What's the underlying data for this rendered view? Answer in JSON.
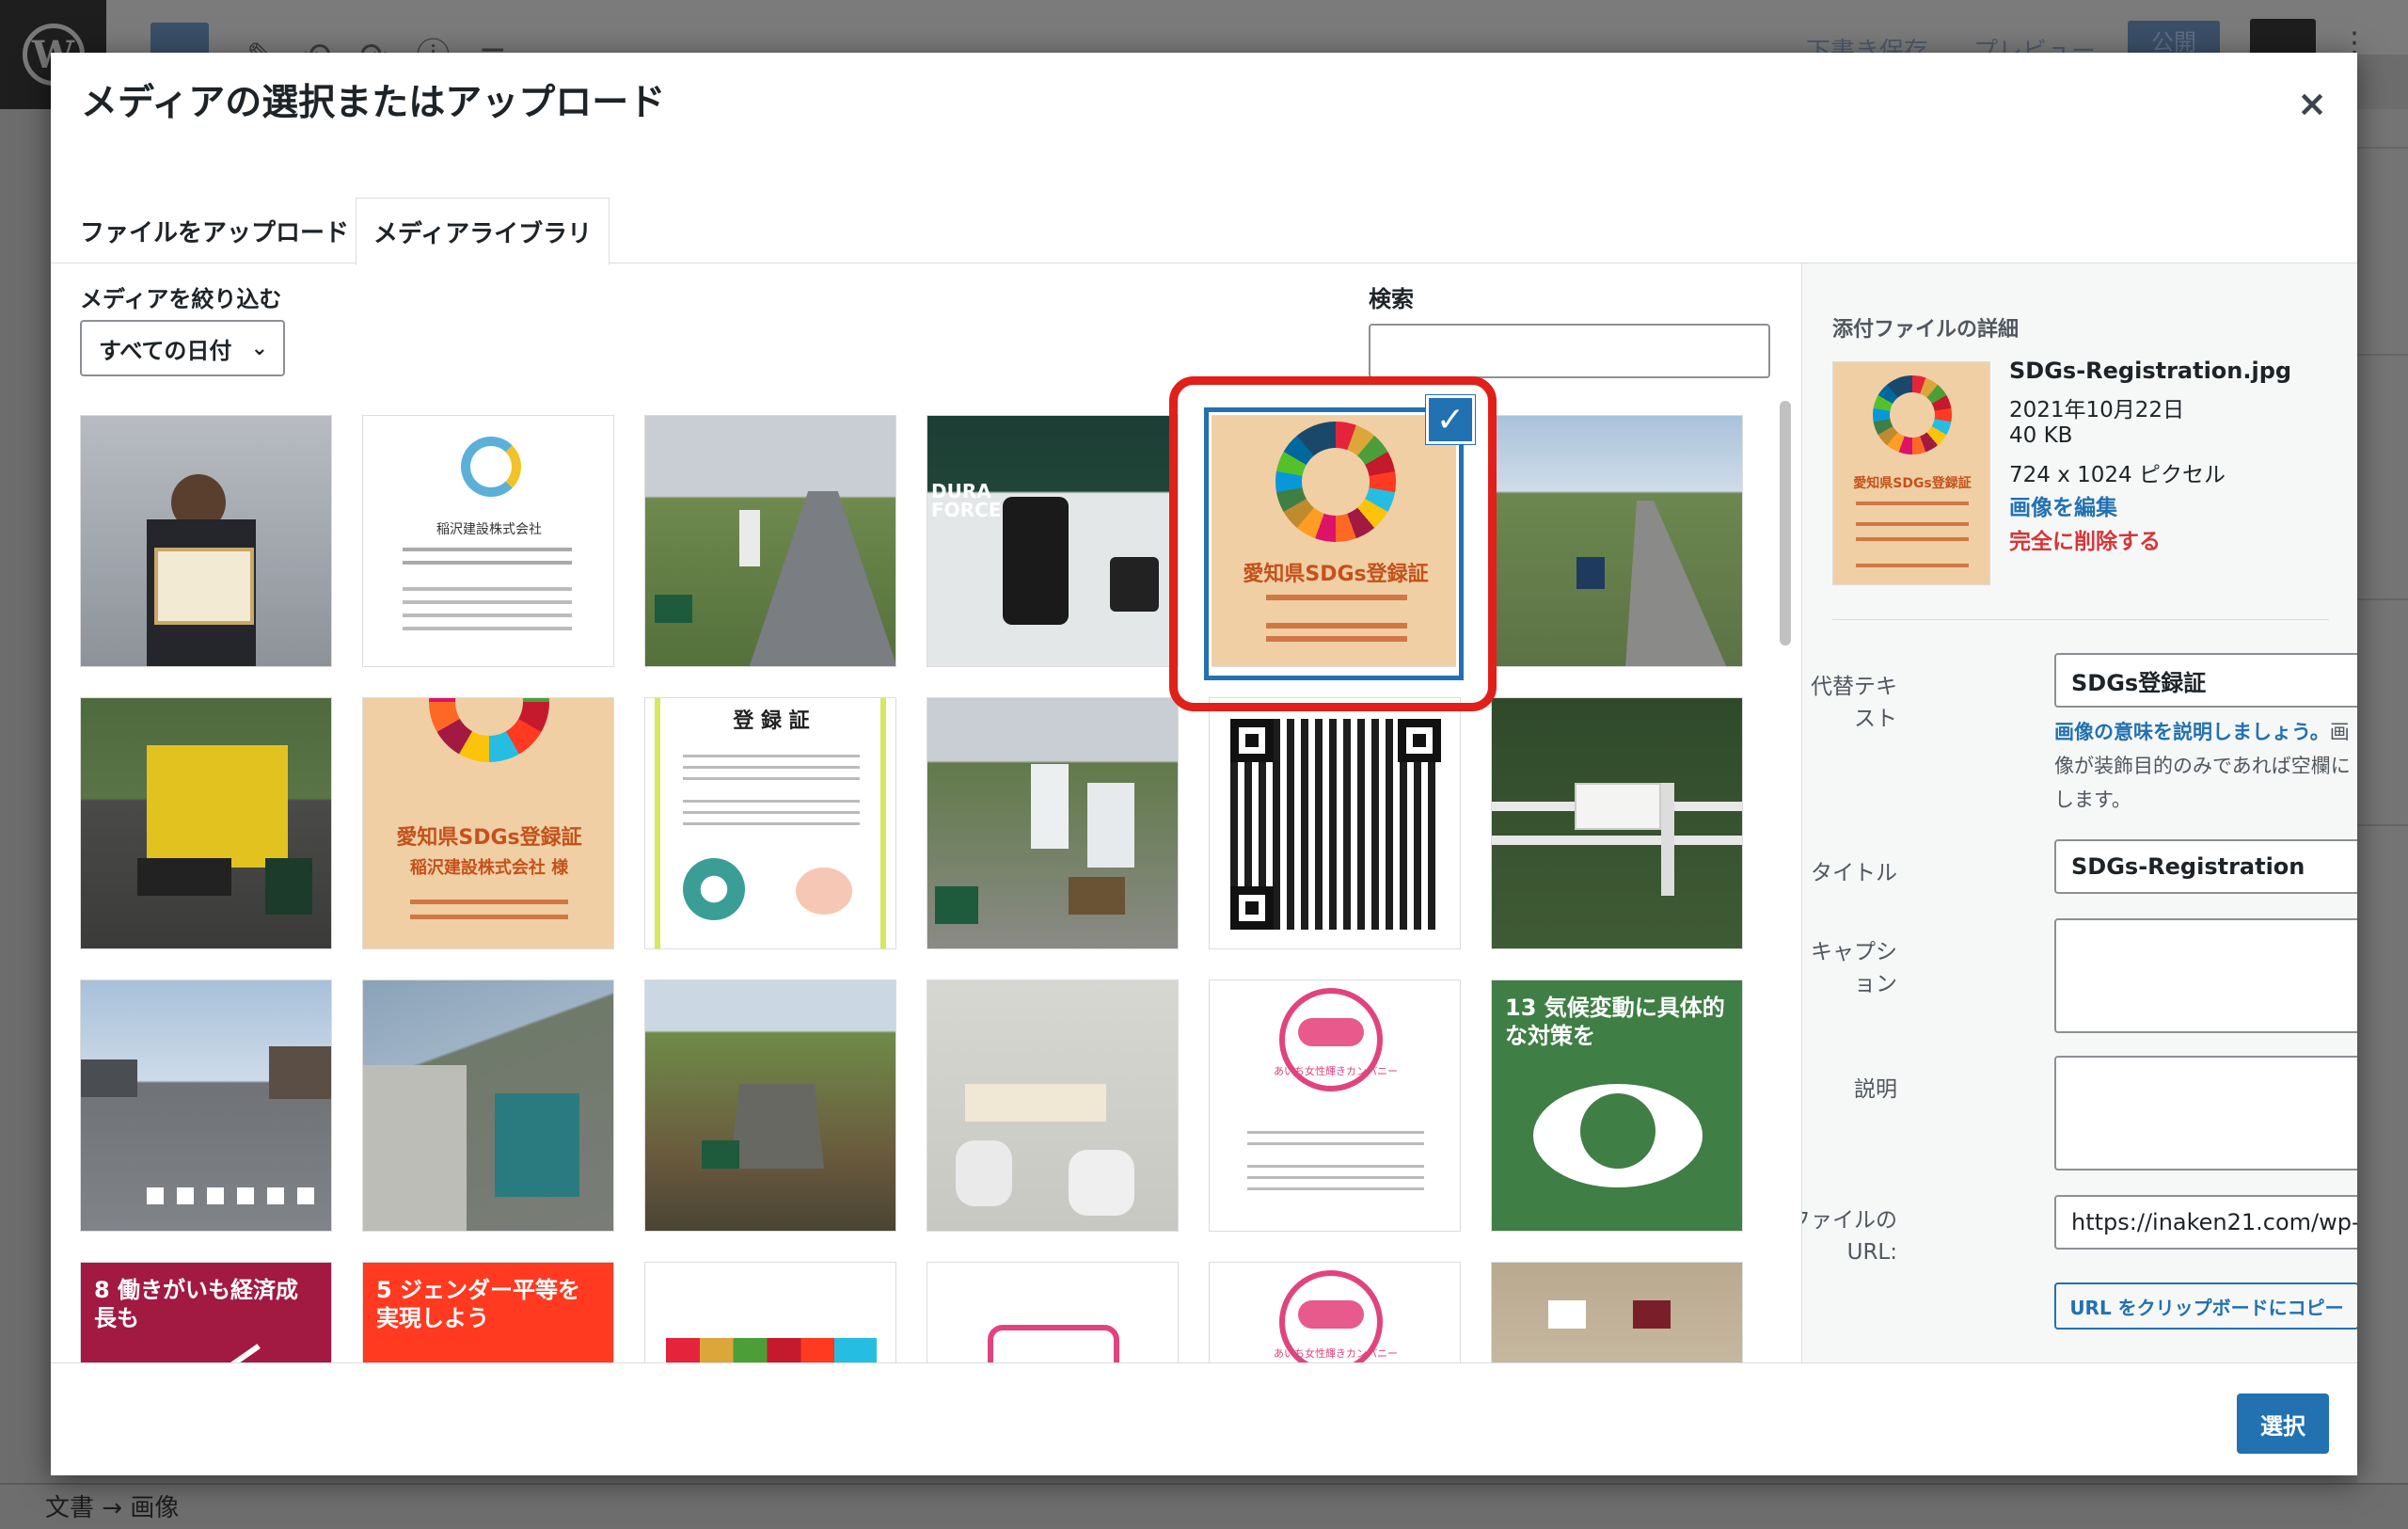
{
  "background": {
    "draft": "下書き保存",
    "preview": "プレビュー",
    "publish": "公開",
    "breadcrumb": "文書 → 画像"
  },
  "modal": {
    "title": "メディアの選択またはアップロード",
    "close": "×",
    "tabs": [
      {
        "label": "ファイルをアップロード"
      },
      {
        "label": "メディアライブラリ",
        "active": true
      }
    ],
    "filter_label": "メディアを絞り込む",
    "date_filter": "すべての日付",
    "search_label": "検索",
    "search_value": "",
    "select_button": "選択"
  },
  "thumbs": {
    "r1c2_title": "稲沢建設株式会社",
    "r1c6_sdg": "愛知県SDGs登録証",
    "r2c2_sdg": "愛知県SDGs登録証",
    "r2c2_sub": "稲沢建設株式会社 様",
    "r2c3_title": "登 録 証",
    "r3c6_goal": "13 気候変動に具体的な対策を",
    "r4c1_goal": "8 働きがいも経済成長も",
    "r4c2_goal": "5 ジェンダー平等を実現しよう",
    "r3c5_label": "あいち女性輝きカンパニー",
    "r4c5_label": "あいち女性輝きカンパニー",
    "r1c4_brand": "DURA FORCE"
  },
  "details": {
    "heading": "添付ファイルの詳細",
    "filename": "SDGs-Registration.jpg",
    "date": "2021年10月22日",
    "size": "40 KB",
    "dimensions": "724 x 1024 ピクセル",
    "edit_link": "画像を編集",
    "delete_link": "完全に削除する",
    "thumb_sdg": "愛知県SDGs登録証",
    "alt_label": "代替テキスト",
    "alt_value": "SDGs登録証",
    "alt_help_link": "画像の意味を説明しましょう。",
    "alt_help_rest": "画像が装飾目的のみであれば空欄にします。",
    "title_label": "タイトル",
    "title_value": "SDGs-Registration",
    "caption_label": "キャプション",
    "description_label": "説明",
    "url_label": "ファイルの URL:",
    "url_value": "https://inaken21.com/wp-",
    "copy_button": "URL をクリップボードにコピー"
  },
  "colors": {
    "accent": "#2271b1",
    "highlight": "#e0201a",
    "danger": "#d63638"
  }
}
